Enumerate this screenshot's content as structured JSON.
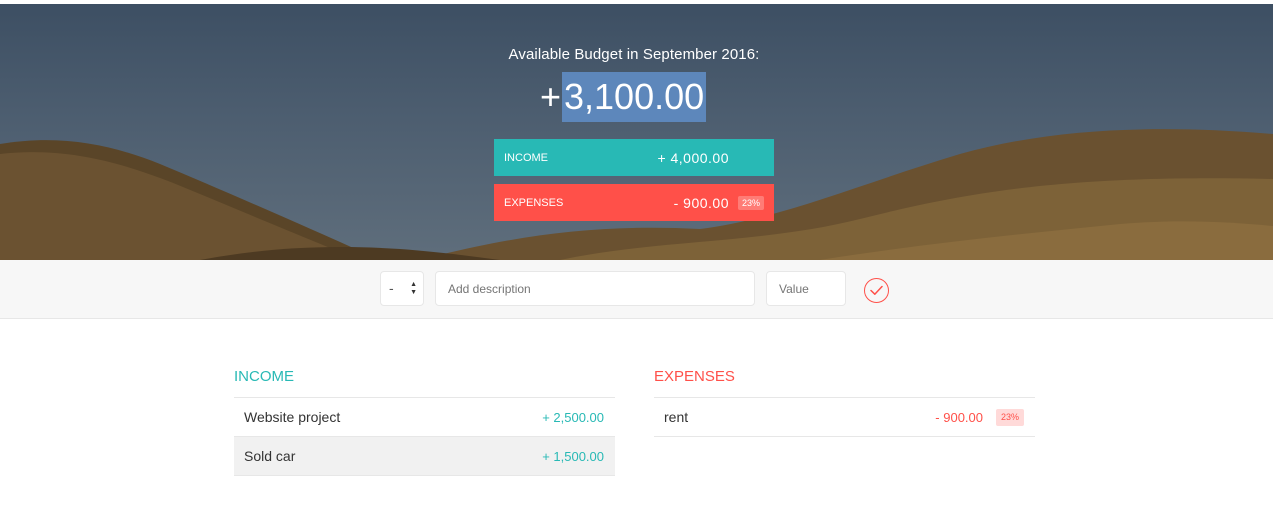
{
  "budget": {
    "title": "Available Budget in September 2016:",
    "sign": "+",
    "value": "3,100.00"
  },
  "summary": {
    "income": {
      "label": "INCOME",
      "value": "+ 4,000.00"
    },
    "expenses": {
      "label": "EXPENSES",
      "value": "- 900.00",
      "percentage": "23%"
    }
  },
  "add_form": {
    "type_selected": "-",
    "description_placeholder": "Add description",
    "value_placeholder": "Value"
  },
  "income": {
    "heading": "INCOME",
    "items": [
      {
        "description": "Website project",
        "value": "+ 2,500.00"
      },
      {
        "description": "Sold car",
        "value": "+ 1,500.00"
      }
    ]
  },
  "expenses": {
    "heading": "EXPENSES",
    "items": [
      {
        "description": "rent",
        "value": "- 900.00",
        "percentage": "23%"
      }
    ]
  },
  "colors": {
    "income": "#28b9b5",
    "expenses": "#ff5049",
    "selection": "#5d87bb"
  }
}
